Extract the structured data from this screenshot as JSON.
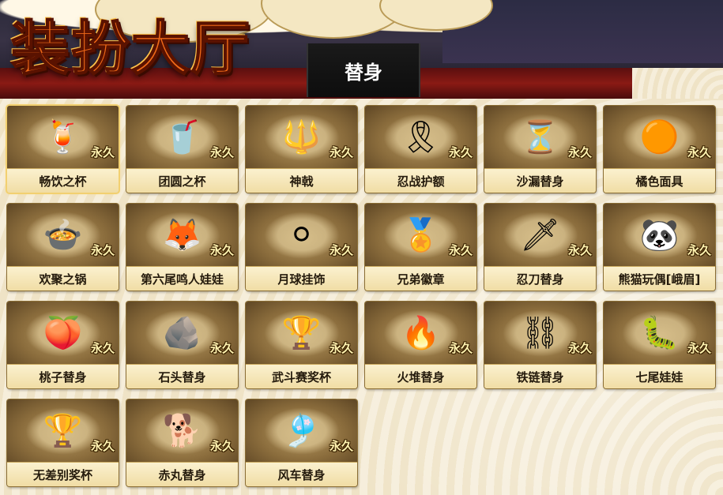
{
  "header": {
    "logo_text": "装扮大厅",
    "tab_label": "替身"
  },
  "items": [
    {
      "name": "畅饮之杯",
      "duration": "永久",
      "icon": "drink-cup-icon",
      "glyph": "🍹",
      "selected": true
    },
    {
      "name": "团圆之杯",
      "duration": "永久",
      "icon": "reunion-cup-icon",
      "glyph": "🥤"
    },
    {
      "name": "神戟",
      "duration": "永久",
      "icon": "divine-halberd-icon",
      "glyph": "🔱"
    },
    {
      "name": "忍战护额",
      "duration": "永久",
      "icon": "ninja-headband-icon",
      "glyph": "🎗"
    },
    {
      "name": "沙漏替身",
      "duration": "永久",
      "icon": "hourglass-icon",
      "glyph": "⏳"
    },
    {
      "name": "橘色面具",
      "duration": "永久",
      "icon": "orange-mask-icon",
      "glyph": "🟠"
    },
    {
      "name": "欢聚之锅",
      "duration": "永久",
      "icon": "hotpot-icon",
      "glyph": "🍲"
    },
    {
      "name": "第六尾鸣人娃娃",
      "duration": "永久",
      "icon": "fox-doll-icon",
      "glyph": "🦊"
    },
    {
      "name": "月球挂饰",
      "duration": "永久",
      "icon": "moon-charm-icon",
      "glyph": "⚪"
    },
    {
      "name": "兄弟徽章",
      "duration": "永久",
      "icon": "brother-badge-icon",
      "glyph": "🏅"
    },
    {
      "name": "忍刀替身",
      "duration": "永久",
      "icon": "ninja-blade-icon",
      "glyph": "🗡"
    },
    {
      "name": "熊猫玩偶[峨眉]",
      "duration": "永久",
      "icon": "panda-doll-icon",
      "glyph": "🐼"
    },
    {
      "name": "桃子替身",
      "duration": "永久",
      "icon": "peach-icon",
      "glyph": "🍑"
    },
    {
      "name": "石头替身",
      "duration": "永久",
      "icon": "stone-icon",
      "glyph": "🪨"
    },
    {
      "name": "武斗赛奖杯",
      "duration": "永久",
      "icon": "tournament-trophy-icon",
      "glyph": "🏆"
    },
    {
      "name": "火堆替身",
      "duration": "永久",
      "icon": "campfire-icon",
      "glyph": "🔥"
    },
    {
      "name": "铁链替身",
      "duration": "永久",
      "icon": "iron-chain-icon",
      "glyph": "⛓"
    },
    {
      "name": "七尾娃娃",
      "duration": "永久",
      "icon": "seven-tail-doll-icon",
      "glyph": "🐛"
    },
    {
      "name": "无差别奖杯",
      "duration": "永久",
      "icon": "open-trophy-icon",
      "glyph": "🏆"
    },
    {
      "name": "赤丸替身",
      "duration": "永久",
      "icon": "akamaru-dog-icon",
      "glyph": "🐕"
    },
    {
      "name": "风车替身",
      "duration": "永久",
      "icon": "pinwheel-icon",
      "glyph": "🎐"
    }
  ]
}
